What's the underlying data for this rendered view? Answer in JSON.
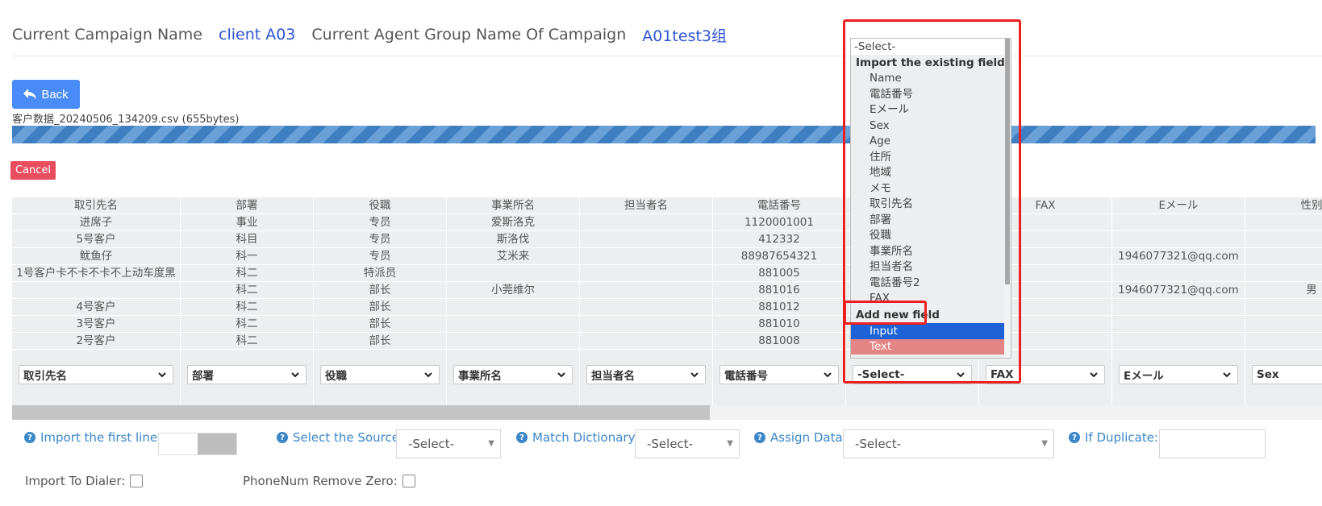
{
  "header": {
    "campaign_label": "Current Campaign Name",
    "campaign_value": "client A03",
    "group_label": "Current Agent Group Name Of Campaign",
    "group_value": "A01test3组"
  },
  "buttons": {
    "back": "Back",
    "cancel": "Cancel"
  },
  "file_info": "客户数据_20240506_134209.csv (655bytes)",
  "table": {
    "columns": [
      {
        "header": "取引先名",
        "cells": [
          "进席子",
          "5号客户",
          "鱿鱼仔",
          "1号客户卡不卡不卡不上动车度黑",
          "",
          "4号客户",
          "3号客户",
          "2号客户"
        ],
        "select": "取引先名"
      },
      {
        "header": "部署",
        "cells": [
          "事业",
          "科目",
          "科一",
          "科二",
          "科二",
          "科二",
          "科二",
          "科二"
        ],
        "select": "部署"
      },
      {
        "header": "役職",
        "cells": [
          "专员",
          "专员",
          "专员",
          "特派员",
          "部长",
          "部长",
          "部长",
          "部长"
        ],
        "select": "役職"
      },
      {
        "header": "事業所名",
        "cells": [
          "爱斯洛克",
          "斯洛伐",
          "艾米来",
          "",
          "小莞维尔",
          "",
          "",
          ""
        ],
        "select": "事業所名"
      },
      {
        "header": "担当者名",
        "cells": [
          "",
          "",
          "",
          "",
          "",
          "",
          "",
          ""
        ],
        "select": "担当者名"
      },
      {
        "header": "電話番号",
        "cells": [
          "1120001001",
          "412332",
          "88987654321",
          "881005",
          "881016",
          "881012",
          "881010",
          "881008"
        ],
        "select": "電話番号"
      },
      {
        "header": "",
        "cells": [
          "",
          "",
          "",
          "",
          "",
          "",
          "",
          ""
        ],
        "select": "-Select-"
      },
      {
        "header": "FAX",
        "cells": [
          "",
          "",
          "",
          "",
          "",
          "",
          "",
          ""
        ],
        "select": "FAX"
      },
      {
        "header": "Eメール",
        "cells": [
          "",
          "",
          "1946077321@qq.com",
          "",
          "1946077321@qq.com",
          "",
          "",
          ""
        ],
        "select": "Eメール"
      },
      {
        "header": "性别",
        "cells": [
          "",
          "",
          "",
          "",
          "男",
          "",
          "",
          ""
        ],
        "select": "Sex"
      }
    ]
  },
  "dropdown": {
    "first": "-Select-",
    "group_existing": "Import the existing field",
    "existing_fields": [
      "Name",
      "電話番号",
      "Eメール",
      "Sex",
      "Age",
      "住所",
      "地域",
      "メモ",
      "取引先名",
      "部署",
      "役職",
      "事業所名",
      "担当者名",
      "電話番号2",
      "FAX"
    ],
    "group_new": "Add new field",
    "new_fields": [
      "Input",
      "Text"
    ]
  },
  "options": {
    "import_first_line": "Import the first line:",
    "select_source": "Select the Source:",
    "source_value": "-Select-",
    "match_dictionary": "Match Dictionary:",
    "dictionary_value": "-Select-",
    "assign_data": "Assign Data:",
    "assign_value": "-Select-",
    "if_duplicate": "If Duplicate:",
    "import_to_dialer": "Import To Dialer:",
    "phone_remove_zero": "PhoneNum Remove Zero:"
  },
  "colors": {
    "accent": "#2f55d4",
    "back_button": "#4a8cf7",
    "cancel_button": "#e94e5f",
    "highlight_box": "#ee1f1f",
    "selected_option": "#1d62d6"
  }
}
